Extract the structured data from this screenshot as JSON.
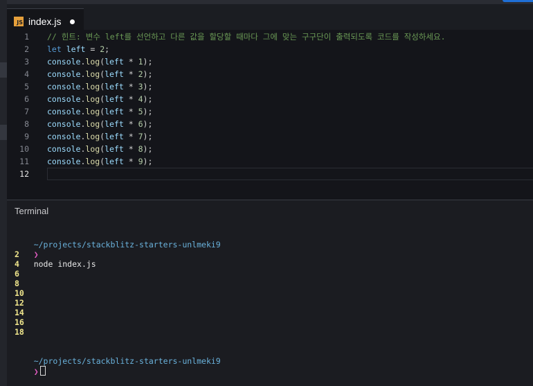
{
  "tab": {
    "icon_text": "JS",
    "label": "index.js"
  },
  "editor": {
    "lines": [
      {
        "n": "1",
        "parts": [
          {
            "cls": "comment",
            "t": "// 힌트: 변수 left를 선언하고 다른 값을 할당할 때마다 그에 맞는 구구단이 출력되도록 코드를 작성하세요."
          }
        ]
      },
      {
        "n": "2",
        "parts": [
          {
            "cls": "kw",
            "t": "let"
          },
          {
            "cls": "op",
            "t": " "
          },
          {
            "cls": "ident",
            "t": "left"
          },
          {
            "cls": "op",
            "t": " = "
          },
          {
            "cls": "num",
            "t": "2"
          },
          {
            "cls": "op",
            "t": ";"
          }
        ]
      },
      {
        "n": "3",
        "parts": [
          {
            "cls": "ident",
            "t": "console"
          },
          {
            "cls": "op",
            "t": "."
          },
          {
            "cls": "fn",
            "t": "log"
          },
          {
            "cls": "op",
            "t": "("
          },
          {
            "cls": "ident",
            "t": "left"
          },
          {
            "cls": "op",
            "t": " * "
          },
          {
            "cls": "num",
            "t": "1"
          },
          {
            "cls": "op",
            "t": ");"
          }
        ]
      },
      {
        "n": "4",
        "parts": [
          {
            "cls": "ident",
            "t": "console"
          },
          {
            "cls": "op",
            "t": "."
          },
          {
            "cls": "fn",
            "t": "log"
          },
          {
            "cls": "op",
            "t": "("
          },
          {
            "cls": "ident",
            "t": "left"
          },
          {
            "cls": "op",
            "t": " * "
          },
          {
            "cls": "num",
            "t": "2"
          },
          {
            "cls": "op",
            "t": ");"
          }
        ]
      },
      {
        "n": "5",
        "parts": [
          {
            "cls": "ident",
            "t": "console"
          },
          {
            "cls": "op",
            "t": "."
          },
          {
            "cls": "fn",
            "t": "log"
          },
          {
            "cls": "op",
            "t": "("
          },
          {
            "cls": "ident",
            "t": "left"
          },
          {
            "cls": "op",
            "t": " * "
          },
          {
            "cls": "num",
            "t": "3"
          },
          {
            "cls": "op",
            "t": ");"
          }
        ]
      },
      {
        "n": "6",
        "parts": [
          {
            "cls": "ident",
            "t": "console"
          },
          {
            "cls": "op",
            "t": "."
          },
          {
            "cls": "fn",
            "t": "log"
          },
          {
            "cls": "op",
            "t": "("
          },
          {
            "cls": "ident",
            "t": "left"
          },
          {
            "cls": "op",
            "t": " * "
          },
          {
            "cls": "num",
            "t": "4"
          },
          {
            "cls": "op",
            "t": ");"
          }
        ]
      },
      {
        "n": "7",
        "parts": [
          {
            "cls": "ident",
            "t": "console"
          },
          {
            "cls": "op",
            "t": "."
          },
          {
            "cls": "fn",
            "t": "log"
          },
          {
            "cls": "op",
            "t": "("
          },
          {
            "cls": "ident",
            "t": "left"
          },
          {
            "cls": "op",
            "t": " * "
          },
          {
            "cls": "num",
            "t": "5"
          },
          {
            "cls": "op",
            "t": ");"
          }
        ]
      },
      {
        "n": "8",
        "parts": [
          {
            "cls": "ident",
            "t": "console"
          },
          {
            "cls": "op",
            "t": "."
          },
          {
            "cls": "fn",
            "t": "log"
          },
          {
            "cls": "op",
            "t": "("
          },
          {
            "cls": "ident",
            "t": "left"
          },
          {
            "cls": "op",
            "t": " * "
          },
          {
            "cls": "num",
            "t": "6"
          },
          {
            "cls": "op",
            "t": ");"
          }
        ]
      },
      {
        "n": "9",
        "parts": [
          {
            "cls": "ident",
            "t": "console"
          },
          {
            "cls": "op",
            "t": "."
          },
          {
            "cls": "fn",
            "t": "log"
          },
          {
            "cls": "op",
            "t": "("
          },
          {
            "cls": "ident",
            "t": "left"
          },
          {
            "cls": "op",
            "t": " * "
          },
          {
            "cls": "num",
            "t": "7"
          },
          {
            "cls": "op",
            "t": ");"
          }
        ]
      },
      {
        "n": "10",
        "parts": [
          {
            "cls": "ident",
            "t": "console"
          },
          {
            "cls": "op",
            "t": "."
          },
          {
            "cls": "fn",
            "t": "log"
          },
          {
            "cls": "op",
            "t": "("
          },
          {
            "cls": "ident",
            "t": "left"
          },
          {
            "cls": "op",
            "t": " * "
          },
          {
            "cls": "num",
            "t": "8"
          },
          {
            "cls": "op",
            "t": ");"
          }
        ]
      },
      {
        "n": "11",
        "parts": [
          {
            "cls": "ident",
            "t": "console"
          },
          {
            "cls": "op",
            "t": "."
          },
          {
            "cls": "fn",
            "t": "log"
          },
          {
            "cls": "op",
            "t": "("
          },
          {
            "cls": "ident",
            "t": "left"
          },
          {
            "cls": "op",
            "t": " * "
          },
          {
            "cls": "num",
            "t": "9"
          },
          {
            "cls": "op",
            "t": ");"
          }
        ]
      },
      {
        "n": "12",
        "parts": []
      }
    ]
  },
  "terminal": {
    "title": "Terminal",
    "path": "~/projects/stackblitz-starters-unlmeki9",
    "prompt_symbol": "❯",
    "command": "node index.js",
    "outputs": [
      "2",
      "4",
      "6",
      "8",
      "10",
      "12",
      "14",
      "16",
      "18"
    ],
    "path2": "~/projects/stackblitz-starters-unlmeki9",
    "prompt_symbol2": "❯"
  }
}
